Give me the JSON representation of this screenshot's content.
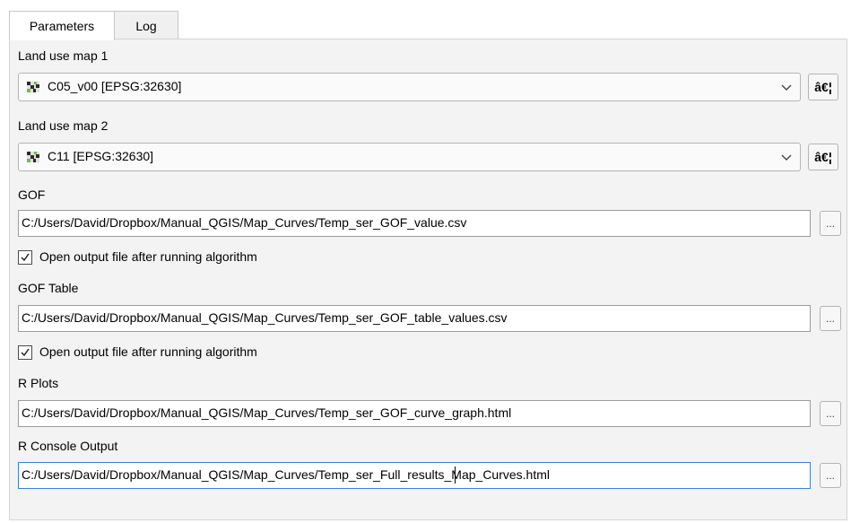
{
  "tabs": [
    {
      "label": "Parameters",
      "active": true
    },
    {
      "label": "Log",
      "active": false
    }
  ],
  "fields": {
    "land_use_map_1": {
      "label": "Land use map 1",
      "value": "C05_v00 [EPSG:32630]",
      "side_button": "â€¦"
    },
    "land_use_map_2": {
      "label": "Land use map 2",
      "value": "C11 [EPSG:32630]",
      "side_button": "â€¦"
    },
    "gof": {
      "label": "GOF",
      "value": "C:/Users/David/Dropbox/Manual_QGIS/Map_Curves/Temp_ser_GOF_value.csv",
      "browse_button": "...",
      "open_after": {
        "label": "Open output file after running algorithm",
        "checked": true
      }
    },
    "gof_table": {
      "label": "GOF Table",
      "value": "C:/Users/David/Dropbox/Manual_QGIS/Map_Curves/Temp_ser_GOF_table_values.csv",
      "browse_button": "...",
      "open_after": {
        "label": "Open output file after running algorithm",
        "checked": true
      }
    },
    "r_plots": {
      "label": "R Plots",
      "value": "C:/Users/David/Dropbox/Manual_QGIS/Map_Curves/Temp_ser_GOF_curve_graph.html",
      "browse_button": "..."
    },
    "r_console_output": {
      "label": "R Console Output",
      "value": "C:/Users/David/Dropbox/Manual_QGIS/Map_Curves/Temp_ser_Full_results_Map_Curves.html",
      "browse_button": "...",
      "focused": true
    }
  },
  "icons": {
    "layer": "raster-layer-icon",
    "dropdown": "chevron-down-icon",
    "check": "checkmark-icon"
  },
  "colors": {
    "panel_bg": "#f3f3f3",
    "focus_border": "#3c7fd6",
    "raster_icon": [
      "#2b2b2b",
      "#7ab648",
      "#e0e0e0"
    ]
  }
}
